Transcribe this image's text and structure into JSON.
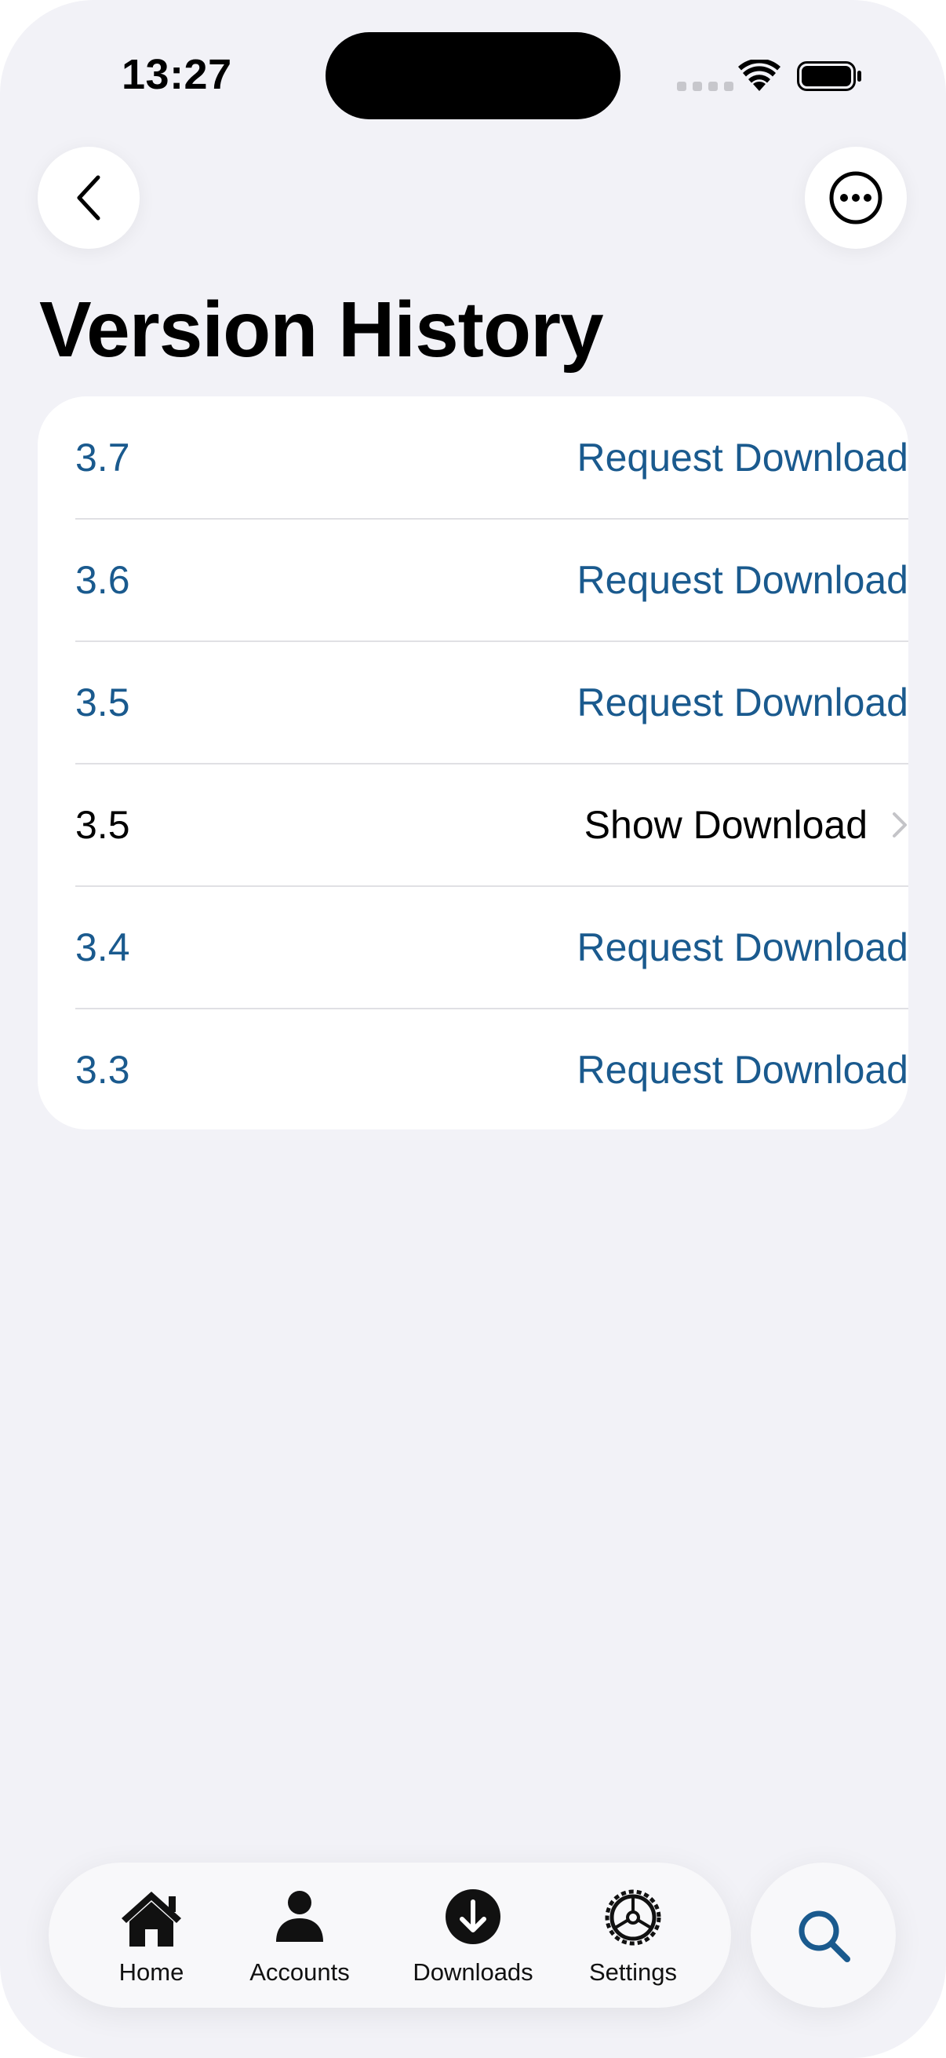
{
  "status": {
    "time": "13:27"
  },
  "nav": {
    "back_icon": "chevron-left-icon",
    "more_icon": "ellipsis-circle-icon"
  },
  "page": {
    "title": "Version History"
  },
  "versions": [
    {
      "version": "3.7",
      "action": "Request Download"
    },
    {
      "version": "3.6",
      "action": "Request Download"
    },
    {
      "version": "3.5",
      "action": "Request Download"
    },
    {
      "version": "3.5",
      "action": "Show Download"
    },
    {
      "version": "3.4",
      "action": "Request Download"
    },
    {
      "version": "3.3",
      "action": "Request Download"
    }
  ],
  "tabs": [
    {
      "label": "Home",
      "icon": "house-icon"
    },
    {
      "label": "Accounts",
      "icon": "person-icon"
    },
    {
      "label": "Downloads",
      "icon": "download-circle-icon"
    },
    {
      "label": "Settings",
      "icon": "gear-icon"
    }
  ],
  "search": {
    "icon": "search-icon"
  },
  "colors": {
    "accent": "#1a5a8e",
    "background": "#f2f2f7",
    "card": "#ffffff",
    "divider": "#e0e0e4"
  }
}
